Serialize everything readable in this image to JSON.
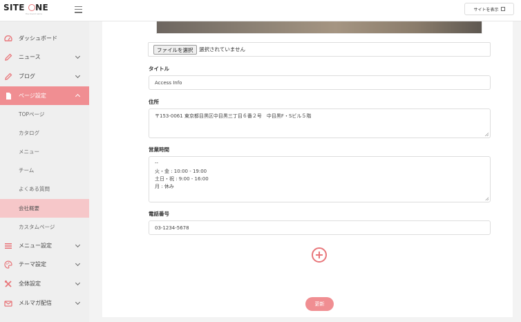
{
  "header": {
    "logo_text_left": "SITE ",
    "logo_text_right": "NE",
    "logo_sub": "the brand name",
    "view_site_label": "サイトを表示"
  },
  "sidebar": {
    "items": [
      {
        "label": "ダッシュボード",
        "icon": "gauge-icon"
      },
      {
        "label": "ニュース",
        "icon": "pencil-icon"
      },
      {
        "label": "ブログ",
        "icon": "pencil-icon"
      },
      {
        "label": "ページ設定",
        "icon": "document-icon"
      },
      {
        "label": "メニュー設定",
        "icon": "list-icon"
      },
      {
        "label": "テーマ設定",
        "icon": "palette-icon"
      },
      {
        "label": "全体設定",
        "icon": "tools-icon"
      },
      {
        "label": "メルマガ配信",
        "icon": "mail-icon"
      }
    ],
    "sub_items": [
      {
        "label": "TOPページ"
      },
      {
        "label": "カタログ"
      },
      {
        "label": "メニュー"
      },
      {
        "label": "チーム"
      },
      {
        "label": "よくある質問"
      },
      {
        "label": "会社概要"
      },
      {
        "label": "カスタムページ"
      }
    ],
    "accent_color": "#f08e92"
  },
  "form": {
    "file_button_label": "ファイルを選択",
    "file_status": "選択されていません",
    "title_label": "タイトル",
    "title_value": "Access Info",
    "address_label": "住所",
    "address_value": "〒153-0061 東京都目黒区中目黒三丁目６番２号　中目黒F・Sビル５階",
    "hours_label": "営業時間",
    "hours_lines": [
      "--",
      "火・金 : 10:00 - 19:00",
      "土日・祝 : 9:00 - 16:00",
      "月 : 休み"
    ],
    "phone_label": "電話番号",
    "phone_value": "03-1234-5678",
    "update_button_label": "更新"
  }
}
